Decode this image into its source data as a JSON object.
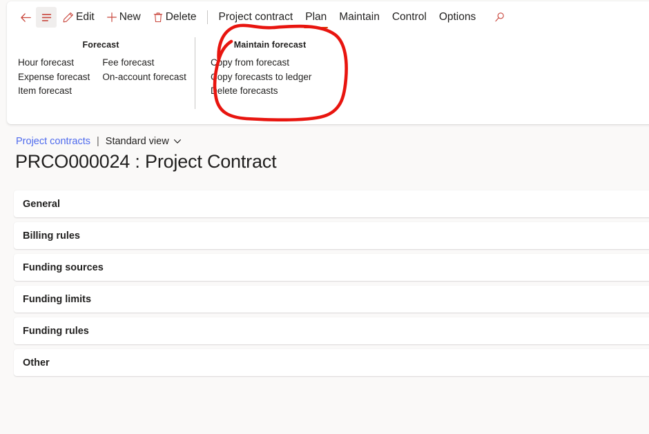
{
  "colors": {
    "accent_red": "#d83b01",
    "icon_red": "#c8443a",
    "link_blue": "#4f6bed",
    "ink_red": "#e8150f",
    "page_bg": "#faf9f8",
    "card_bg": "#ffffff",
    "text": "#201f1e"
  },
  "commandbar": {
    "back_icon": "back-arrow-icon",
    "menu_icon": "hamburger-menu-icon",
    "buttons": [
      {
        "label": "Edit",
        "icon": "pencil-icon"
      },
      {
        "label": "New",
        "icon": "plus-icon"
      },
      {
        "label": "Delete",
        "icon": "trash-icon"
      }
    ],
    "tabs": [
      {
        "label": "Project contract",
        "selected": false
      },
      {
        "label": "Plan",
        "selected": true
      },
      {
        "label": "Maintain",
        "selected": false
      },
      {
        "label": "Control",
        "selected": false
      },
      {
        "label": "Options",
        "selected": false
      }
    ],
    "search_icon": "search-icon"
  },
  "ribbon": {
    "groups": [
      {
        "title": "Forecast",
        "columns": [
          [
            "Hour forecast",
            "Expense forecast",
            "Item forecast"
          ],
          [
            "Fee forecast",
            "On-account forecast"
          ]
        ]
      },
      {
        "title": "Maintain forecast",
        "columns": [
          [
            "Copy from forecast",
            "Copy forecasts to ledger",
            "Delete forecasts"
          ]
        ]
      }
    ]
  },
  "annotation": {
    "type": "hand-drawn-red-circle",
    "target": "Maintain forecast group"
  },
  "page": {
    "breadcrumb": {
      "parent": "Project contracts",
      "separator": "|",
      "view": "Standard view",
      "view_chevron": "chevron-down-icon"
    },
    "title": "PRCO000024 : Project Contract",
    "fasttabs": [
      {
        "label": "General"
      },
      {
        "label": "Billing rules"
      },
      {
        "label": "Funding sources"
      },
      {
        "label": "Funding limits"
      },
      {
        "label": "Funding rules"
      },
      {
        "label": "Other"
      }
    ]
  }
}
